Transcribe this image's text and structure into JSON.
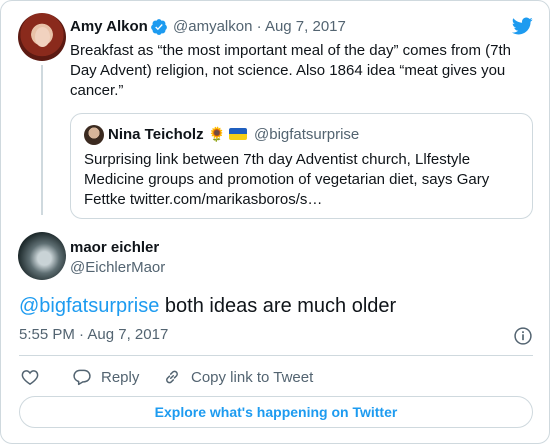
{
  "parent_tweet": {
    "author_name": "Amy Alkon",
    "handle": "@amyalkon",
    "separator": "·",
    "date": "Aug 7, 2017",
    "text": "Breakfast as “the most important meal of the day” comes from (7th Day Advent) religion, not science. Also 1864 idea “meat gives you cancer.”"
  },
  "quoted_tweet": {
    "author_name": "Nina Teicholz",
    "emoji": "🌻",
    "handle": "@bigfatsurprise",
    "text": "Surprising link between 7th day Adventist church, Llfestyle Medicine groups and promotion of vegetarian diet, says Gary Fettke twitter.com/marikasboros/s…"
  },
  "reply_tweet": {
    "author_name": "maor eichler",
    "handle": "@EichlerMaor",
    "mention": "@bigfatsurprise",
    "text": " both ideas are much older",
    "time": "5:55 PM",
    "separator": "·",
    "date": "Aug 7, 2017"
  },
  "actions": {
    "reply_label": "Reply",
    "copy_label": "Copy link to Tweet"
  },
  "explore_label": "Explore what's happening on Twitter",
  "icons": {
    "brand": "twitter-bird-icon",
    "verified": "verified-badge-icon",
    "info": "info-icon",
    "like": "heart-icon",
    "reply": "reply-bubble-icon",
    "copy": "link-icon"
  },
  "colors": {
    "accent": "#1d9bf0",
    "text": "#0f1419",
    "muted": "#536471",
    "border": "#cfd9de"
  }
}
